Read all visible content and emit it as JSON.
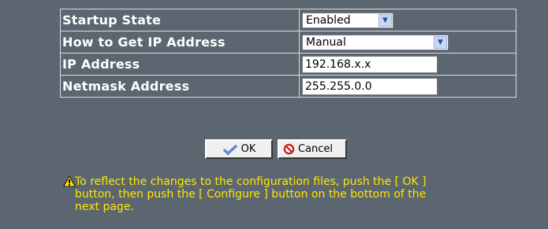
{
  "settings": {
    "rows": [
      {
        "label": "Startup State",
        "type": "select",
        "value": "Enabled"
      },
      {
        "label": "How to Get IP Address",
        "type": "select",
        "value": "Manual"
      },
      {
        "label": "IP Address",
        "type": "input",
        "value": "192.168.x.x"
      },
      {
        "label": "Netmask Address",
        "type": "input",
        "value": "255.255.0.0"
      }
    ]
  },
  "buttons": {
    "ok_label": "OK",
    "cancel_label": "Cancel"
  },
  "notice": {
    "text": "To reflect the changes to the configuration files, push the [ OK ]\nbutton, then push the [ Configure ] button on the bottom of the\nnext page."
  },
  "colors": {
    "background": "#5c6670",
    "label_text": "#ffffff",
    "notice_text": "#ffe600",
    "cancel_icon": "#d01818",
    "ok_icon": "#2a52c8"
  },
  "icons": {
    "ok": "checkmark-icon",
    "cancel": "prohibited-icon",
    "notice": "warning-icon",
    "dropdown": "chevron-down-icon"
  }
}
